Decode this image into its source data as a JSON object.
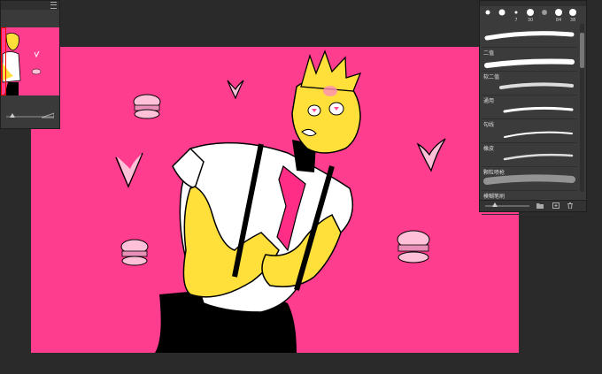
{
  "brush_panel": {
    "sizes": [
      "",
      "",
      "7",
      "30",
      "",
      "84",
      "38"
    ],
    "brushes": [
      {
        "label": ""
      },
      {
        "label": "二值"
      },
      {
        "label": "软二值"
      },
      {
        "label": "通用"
      },
      {
        "label": "勾线"
      },
      {
        "label": "橡皮"
      },
      {
        "label": "颗粒喷枪"
      },
      {
        "label": "模糊笔刷"
      }
    ]
  },
  "colors": {
    "canvas_bg": "#ff3d8e",
    "workspace": "#2a2a2a",
    "panel": "#3b3b3b",
    "skin": "#ffe03a",
    "shirt": "#ffffff",
    "line": "#000000"
  },
  "icons": {
    "navigator_menu": "hamburger-icon",
    "zoom": "zoom-icon",
    "folder": "folder-icon",
    "new_brush": "new-icon",
    "trash": "trash-icon"
  }
}
